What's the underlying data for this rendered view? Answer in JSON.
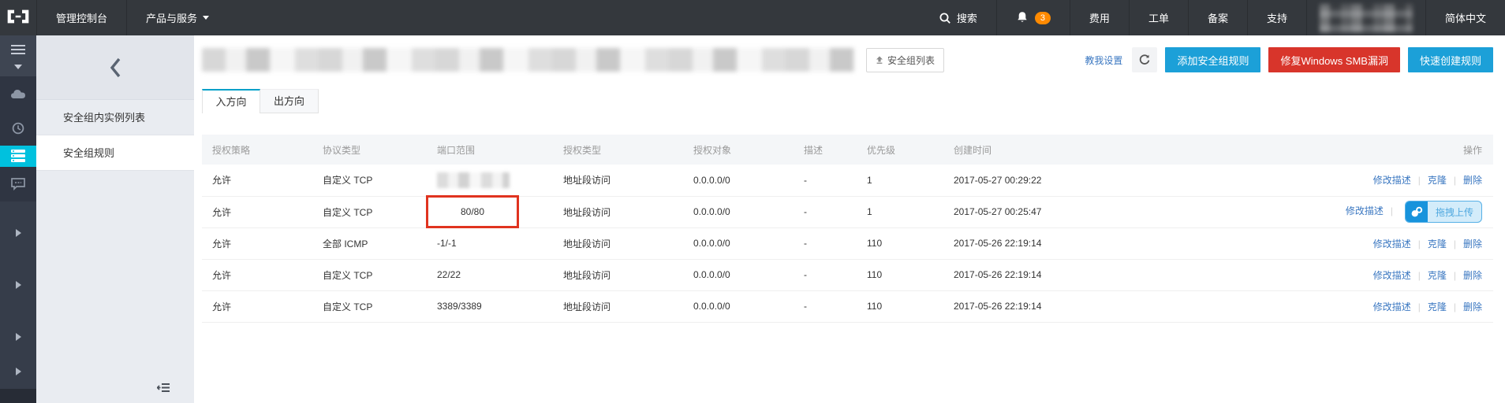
{
  "topnav": {
    "console": "管理控制台",
    "products": "产品与服务",
    "search": "搜索",
    "notification_count": "3",
    "billing": "费用",
    "ticket": "工单",
    "beian": "备案",
    "support": "支持",
    "language": "简体中文"
  },
  "subsidebar": {
    "items": [
      {
        "label": "安全组内实例列表",
        "active": false
      },
      {
        "label": "安全组规则",
        "active": true
      }
    ]
  },
  "header": {
    "list_button": "安全组列表",
    "help_link": "教我设置",
    "add_rule_button": "添加安全组规则",
    "fix_smb_button": "修复Windows SMB漏洞",
    "quick_create_button": "快速创建规则"
  },
  "tabs": [
    {
      "label": "入方向",
      "active": true
    },
    {
      "label": "出方向",
      "active": false
    }
  ],
  "table": {
    "headers": [
      "授权策略",
      "协议类型",
      "端口范围",
      "授权类型",
      "授权对象",
      "描述",
      "优先级",
      "创建时间",
      "操作"
    ],
    "rows": [
      {
        "policy": "允许",
        "protocol": "自定义 TCP",
        "port": "",
        "port_blurred": true,
        "port_highlight": false,
        "auth_type": "地址段访问",
        "auth_object": "0.0.0.0/0",
        "desc": "-",
        "priority": "1",
        "created": "2017-05-27 00:29:22",
        "actions": [
          "修改描述",
          "克隆",
          "删除"
        ],
        "overlay": null
      },
      {
        "policy": "允许",
        "protocol": "自定义 TCP",
        "port": "80/80",
        "port_blurred": false,
        "port_highlight": true,
        "auth_type": "地址段访问",
        "auth_object": "0.0.0.0/0",
        "desc": "-",
        "priority": "1",
        "created": "2017-05-27 00:25:47",
        "actions": [
          "修改描述"
        ],
        "overlay": "拖拽上传"
      },
      {
        "policy": "允许",
        "protocol": "全部 ICMP",
        "port": "-1/-1",
        "port_blurred": false,
        "port_highlight": false,
        "auth_type": "地址段访问",
        "auth_object": "0.0.0.0/0",
        "desc": "-",
        "priority": "110",
        "created": "2017-05-26 22:19:14",
        "actions": [
          "修改描述",
          "克隆",
          "删除"
        ],
        "overlay": null
      },
      {
        "policy": "允许",
        "protocol": "自定义 TCP",
        "port": "22/22",
        "port_blurred": false,
        "port_highlight": false,
        "auth_type": "地址段访问",
        "auth_object": "0.0.0.0/0",
        "desc": "-",
        "priority": "110",
        "created": "2017-05-26 22:19:14",
        "actions": [
          "修改描述",
          "克隆",
          "删除"
        ],
        "overlay": null
      },
      {
        "policy": "允许",
        "protocol": "自定义 TCP",
        "port": "3389/3389",
        "port_blurred": false,
        "port_highlight": false,
        "auth_type": "地址段访问",
        "auth_object": "0.0.0.0/0",
        "desc": "-",
        "priority": "110",
        "created": "2017-05-26 22:19:14",
        "actions": [
          "修改描述",
          "克隆",
          "删除"
        ],
        "overlay": null
      }
    ]
  },
  "colors": {
    "accent_blue": "#1CA0D8",
    "danger_red": "#D8352B",
    "active_cyan": "#00C1DE",
    "link_blue": "#3A77C1",
    "badge_orange": "#FF8A00",
    "tab_teal": "#00A0C9",
    "highlight_red": "#E0331F"
  }
}
